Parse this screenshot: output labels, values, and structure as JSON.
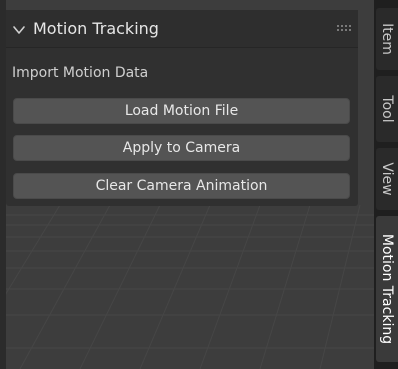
{
  "panel": {
    "title": "Motion Tracking",
    "section_label": "Import Motion Data",
    "buttons": {
      "load": "Load Motion File",
      "apply": "Apply to Camera",
      "clear": "Clear Camera Animation"
    }
  },
  "tabs": {
    "item": "Item",
    "tool": "Tool",
    "view": "View",
    "motion_tracking": "Motion Tracking"
  },
  "colors": {
    "viewport_bg": "#3d3d3d",
    "panel_bg": "#303030",
    "button_bg": "#545454",
    "tab_bar_bg": "#1f1f1f"
  },
  "icons": {
    "collapse": "chevron-down-icon",
    "drag": "drag-handle-icon"
  }
}
